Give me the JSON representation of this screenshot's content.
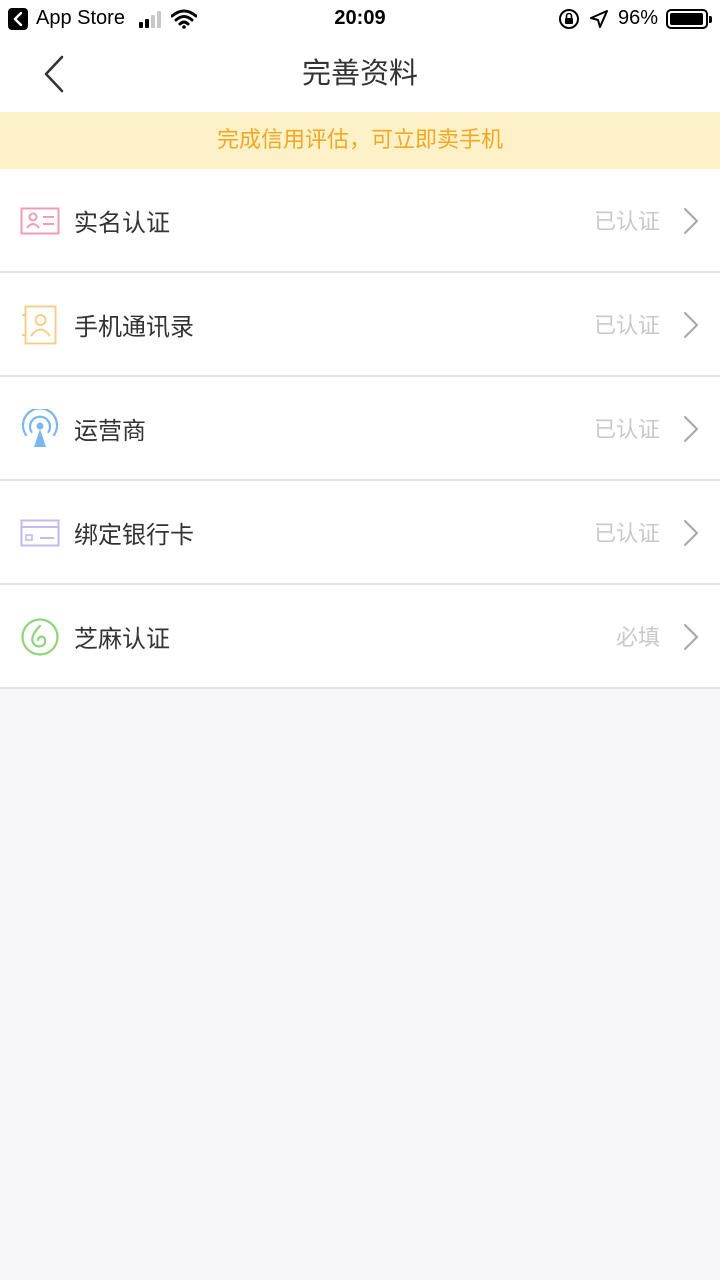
{
  "status_bar": {
    "back_app": "App Store",
    "time": "20:09",
    "battery": "96%",
    "battery_level": 0.96
  },
  "nav": {
    "title": "完善资料"
  },
  "notice": {
    "text": "完成信用评估，可立即卖手机"
  },
  "items": [
    {
      "label": "实名认证",
      "status": "已认证",
      "icon": "id-card-icon",
      "color": "#f29bb8"
    },
    {
      "label": "手机通讯录",
      "status": "已认证",
      "icon": "contacts-book-icon",
      "color": "#f5cf8a"
    },
    {
      "label": "运营商",
      "status": "已认证",
      "icon": "signal-tower-icon",
      "color": "#7db6ef"
    },
    {
      "label": "绑定银行卡",
      "status": "已认证",
      "icon": "bank-card-icon",
      "color": "#c5b8ef"
    },
    {
      "label": "芝麻认证",
      "status": "必填",
      "icon": "sesame-icon",
      "color": "#8fd27a"
    }
  ]
}
